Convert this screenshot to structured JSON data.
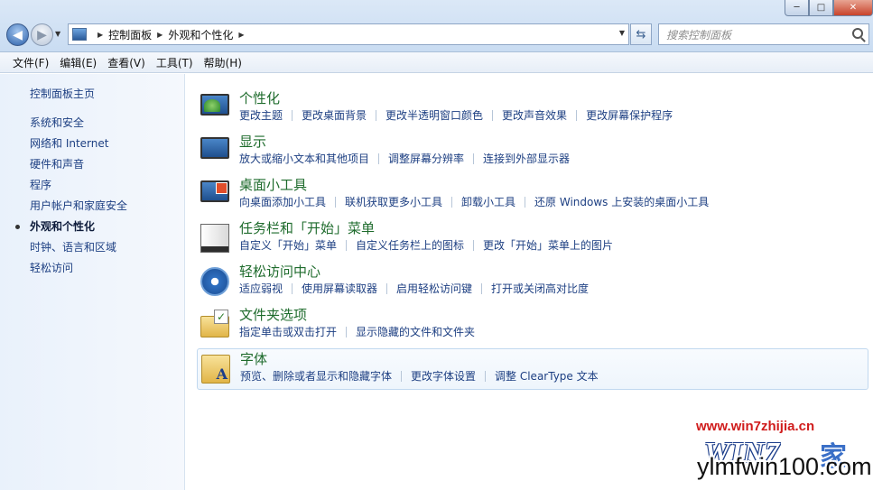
{
  "window": {
    "minimize": "─",
    "maximize": "□",
    "close": "✕"
  },
  "address": {
    "breadcrumbs": [
      "控制面板",
      "外观和个性化"
    ]
  },
  "search": {
    "placeholder": "搜索控制面板"
  },
  "menu": [
    "文件(F)",
    "编辑(E)",
    "查看(V)",
    "工具(T)",
    "帮助(H)"
  ],
  "sidebar": {
    "home": "控制面板主页",
    "items": [
      {
        "label": "系统和安全"
      },
      {
        "label": "网络和 Internet"
      },
      {
        "label": "硬件和声音"
      },
      {
        "label": "程序"
      },
      {
        "label": "用户帐户和家庭安全"
      },
      {
        "label": "外观和个性化",
        "active": true
      },
      {
        "label": "时钟、语言和区域"
      },
      {
        "label": "轻松访问"
      }
    ]
  },
  "categories": [
    {
      "icon": "personalization-icon",
      "title": "个性化",
      "links": [
        "更改主题",
        "更改桌面背景",
        "更改半透明窗口颜色",
        "更改声音效果",
        "更改屏幕保护程序"
      ]
    },
    {
      "icon": "display-icon",
      "title": "显示",
      "links": [
        "放大或缩小文本和其他项目",
        "调整屏幕分辨率",
        "连接到外部显示器"
      ]
    },
    {
      "icon": "desktop-gadgets-icon",
      "title": "桌面小工具",
      "links": [
        "向桌面添加小工具",
        "联机获取更多小工具",
        "卸载小工具",
        "还原 Windows 上安装的桌面小工具"
      ]
    },
    {
      "icon": "taskbar-start-menu-icon",
      "title": "任务栏和「开始」菜单",
      "links": [
        "自定义「开始」菜单",
        "自定义任务栏上的图标",
        "更改「开始」菜单上的图片"
      ]
    },
    {
      "icon": "ease-of-access-icon",
      "title": "轻松访问中心",
      "links": [
        "适应弱视",
        "使用屏幕读取器",
        "启用轻松访问键",
        "打开或关闭高对比度"
      ]
    },
    {
      "icon": "folder-options-icon",
      "title": "文件夹选项",
      "links": [
        "指定单击或双击打开",
        "显示隐藏的文件和文件夹"
      ]
    },
    {
      "icon": "fonts-icon",
      "title": "字体",
      "links": [
        "预览、删除或者显示和隐藏字体",
        "更改字体设置",
        "调整 ClearType 文本"
      ],
      "selected": true
    }
  ],
  "watermark": {
    "url": "www.win7zhijia.cn",
    "logo": "WIN7",
    "logo_tail": "家",
    "site": "ylmfwin100.com"
  }
}
